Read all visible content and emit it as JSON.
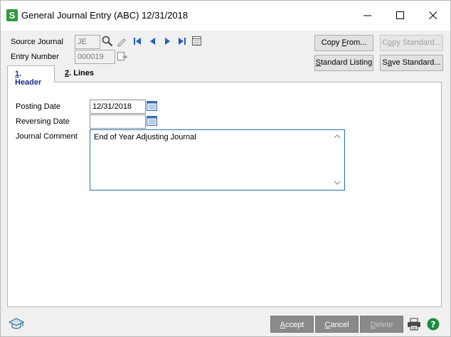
{
  "window": {
    "title": "General Journal Entry (ABC) 12/31/2018",
    "logo_letter": "S"
  },
  "fields": {
    "source_journal_label": "Source Journal",
    "source_journal_value": "JE",
    "entry_number_label": "Entry Number",
    "entry_number_value": "000019",
    "posting_date_label": "Posting Date",
    "posting_date_value": "12/31/2018",
    "reversing_date_label": "Reversing Date",
    "reversing_date_value": "",
    "journal_comment_label": "Journal Comment",
    "journal_comment_value": "End of Year Adjusting Journal"
  },
  "buttons": {
    "copy_from": {
      "pre": "Copy ",
      "ul": "F",
      "post": "rom..."
    },
    "copy_standard": {
      "pre": "C",
      "ul": "o",
      "post": "py Standard..."
    },
    "standard_listing": {
      "pre": "",
      "ul": "S",
      "post": "tandard Listing"
    },
    "save_standard": {
      "pre": "S",
      "ul": "a",
      "post": "ve Standard..."
    },
    "accept": {
      "pre": "",
      "ul": "A",
      "post": "ccept"
    },
    "cancel": {
      "pre": "",
      "ul": "C",
      "post": "ancel"
    },
    "delete": {
      "pre": "",
      "ul": "D",
      "post": "elete"
    }
  },
  "tabs": [
    {
      "num": "1",
      "label": ". Header"
    },
    {
      "num": "2",
      "label": ". Lines"
    }
  ],
  "colors": {
    "accent": "#1a2f8a",
    "logo": "#2f9a3a",
    "bottom_button": "#8a8a8a"
  }
}
